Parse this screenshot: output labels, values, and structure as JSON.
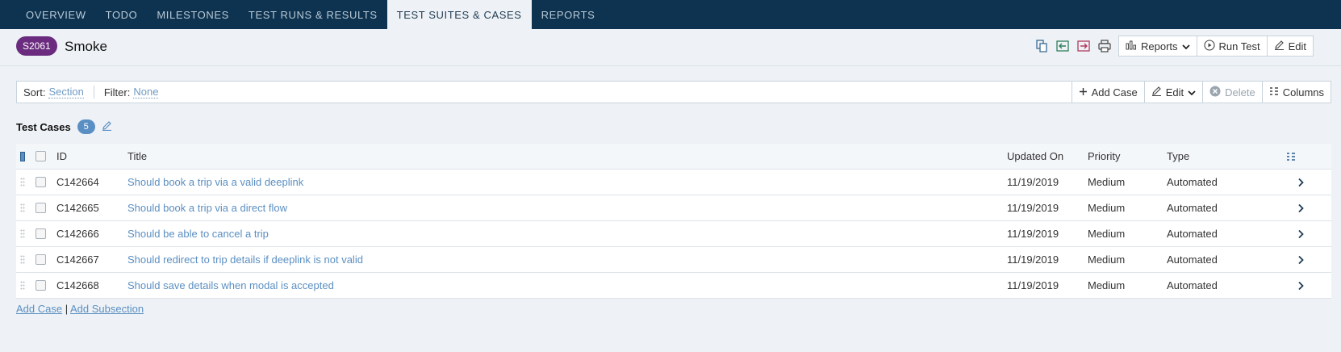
{
  "nav": {
    "tabs": [
      "OVERVIEW",
      "TODO",
      "MILESTONES",
      "TEST RUNS & RESULTS",
      "TEST SUITES & CASES",
      "REPORTS"
    ],
    "active": "TEST SUITES & CASES"
  },
  "header": {
    "suite_id": "S2061",
    "suite_name": "Smoke",
    "icons": [
      "copy-icon",
      "import-icon",
      "export-icon",
      "print-icon"
    ],
    "reports_label": "Reports",
    "run_test_label": "Run Test",
    "edit_label": "Edit"
  },
  "filterbar": {
    "sort_label": "Sort:",
    "sort_value": "Section",
    "filter_label": "Filter:",
    "filter_value": "None",
    "add_case_label": "Add Case",
    "edit_label": "Edit",
    "delete_label": "Delete",
    "columns_label": "Columns"
  },
  "cases": {
    "heading": "Test Cases",
    "count": "5",
    "columns": {
      "id": "ID",
      "title": "Title",
      "updated": "Updated On",
      "priority": "Priority",
      "type": "Type"
    },
    "rows": [
      {
        "id": "C142664",
        "title": "Should book a trip via a valid deeplink",
        "updated": "11/19/2019",
        "priority": "Medium",
        "type": "Automated"
      },
      {
        "id": "C142665",
        "title": "Should book a trip via a direct flow",
        "updated": "11/19/2019",
        "priority": "Medium",
        "type": "Automated"
      },
      {
        "id": "C142666",
        "title": "Should be able to cancel a trip",
        "updated": "11/19/2019",
        "priority": "Medium",
        "type": "Automated"
      },
      {
        "id": "C142667",
        "title": "Should redirect to trip details if deeplink is not valid",
        "updated": "11/19/2019",
        "priority": "Medium",
        "type": "Automated"
      },
      {
        "id": "C142668",
        "title": "Should save details when modal is accepted",
        "updated": "11/19/2019",
        "priority": "Medium",
        "type": "Automated"
      }
    ]
  },
  "footer": {
    "add_case": "Add Case",
    "separator": "|",
    "add_subsection": "Add Subsection"
  },
  "colors": {
    "nav_bg": "#0e3350",
    "badge": "#6b2b7f",
    "link": "#5b8fc2"
  }
}
